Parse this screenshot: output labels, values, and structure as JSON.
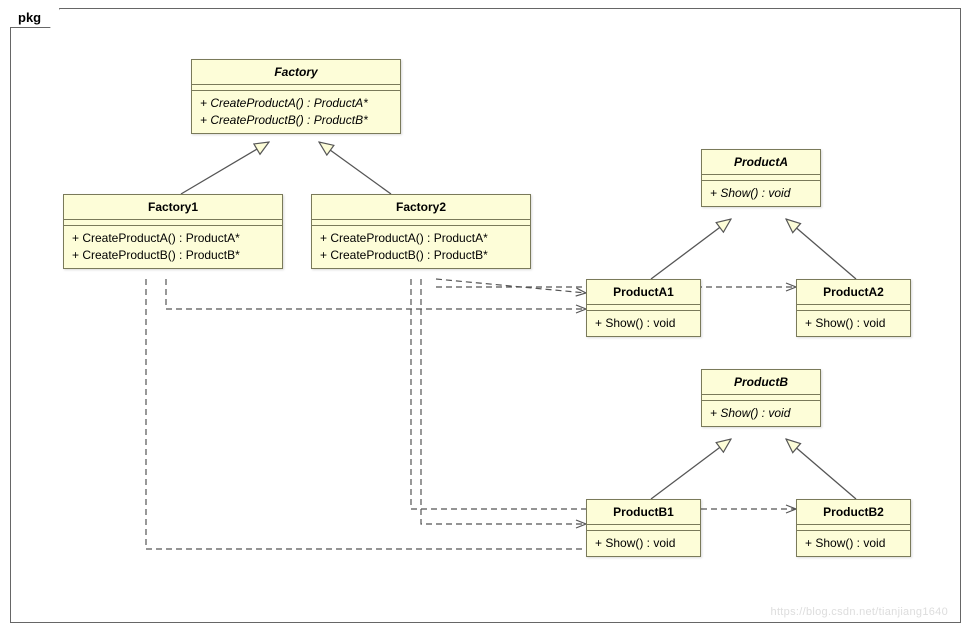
{
  "package": {
    "name": "pkg"
  },
  "classes": {
    "factory": {
      "name": "Factory",
      "abstract": true,
      "ops": [
        "+ CreateProductA() : ProductA*",
        "+ CreateProductB() : ProductB*"
      ]
    },
    "factory1": {
      "name": "Factory1",
      "abstract": false,
      "ops": [
        "+ CreateProductA() : ProductA*",
        "+ CreateProductB() : ProductB*"
      ]
    },
    "factory2": {
      "name": "Factory2",
      "abstract": false,
      "ops": [
        "+ CreateProductA() : ProductA*",
        "+ CreateProductB() : ProductB*"
      ]
    },
    "productA": {
      "name": "ProductA",
      "abstract": true,
      "ops": [
        "+ Show() : void"
      ]
    },
    "productA1": {
      "name": "ProductA1",
      "abstract": false,
      "ops": [
        "+ Show() : void"
      ]
    },
    "productA2": {
      "name": "ProductA2",
      "abstract": false,
      "ops": [
        "+ Show() : void"
      ]
    },
    "productB": {
      "name": "ProductB",
      "abstract": true,
      "ops": [
        "+ Show() : void"
      ]
    },
    "productB1": {
      "name": "ProductB1",
      "abstract": false,
      "ops": [
        "+ Show() : void"
      ]
    },
    "productB2": {
      "name": "ProductB2",
      "abstract": false,
      "ops": [
        "+ Show() : void"
      ]
    }
  },
  "relationships": {
    "generalizations": [
      {
        "child": "Factory1",
        "parent": "Factory"
      },
      {
        "child": "Factory2",
        "parent": "Factory"
      },
      {
        "child": "ProductA1",
        "parent": "ProductA"
      },
      {
        "child": "ProductA2",
        "parent": "ProductA"
      },
      {
        "child": "ProductB1",
        "parent": "ProductB"
      },
      {
        "child": "ProductB2",
        "parent": "ProductB"
      }
    ],
    "dependencies": [
      {
        "from": "Factory1",
        "to": "ProductA1"
      },
      {
        "from": "Factory1",
        "to": "ProductB1"
      },
      {
        "from": "Factory2",
        "to": "ProductA2"
      },
      {
        "from": "Factory2",
        "to": "ProductB2"
      }
    ]
  },
  "watermark": "https://blog.csdn.net/tianjiang1640"
}
